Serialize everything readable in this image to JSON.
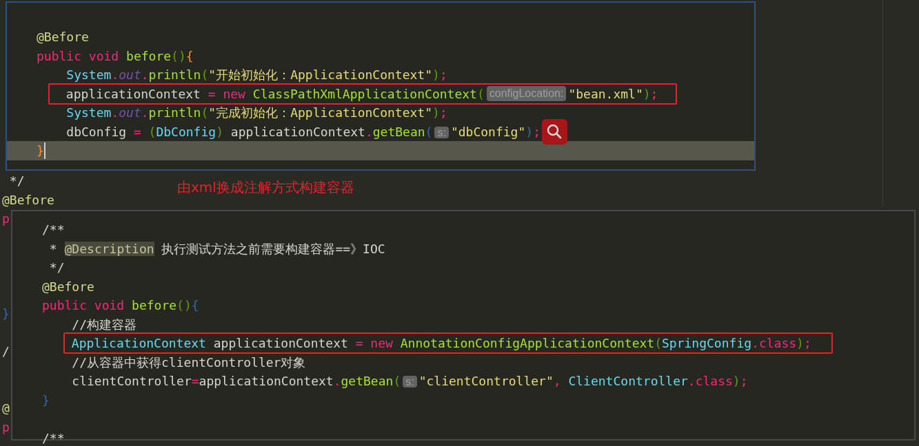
{
  "background_editor": {
    "lines": [
      {
        "segments": [
          {
            "kind": "code",
            "tokens": [
              {
                "kind": "plain",
                "text": " */"
              }
            ]
          }
        ]
      },
      {
        "segments": [
          {
            "kind": "code",
            "tokens": [
              {
                "kind": "annotation",
                "text": "@Before"
              }
            ]
          }
        ]
      },
      {
        "segments": [
          {
            "kind": "code",
            "tokens": [
              {
                "kind": "keyword",
                "text": "p"
              }
            ]
          }
        ]
      },
      {
        "segments": [
          {
            "kind": "code",
            "tokens": [
              {
                "kind": "bracket",
                "text": "}"
              }
            ]
          }
        ]
      },
      {
        "segments": [
          {
            "kind": "code",
            "tokens": [
              {
                "kind": "plain",
                "text": "/"
              }
            ]
          }
        ]
      },
      {
        "segments": [
          {
            "kind": "code",
            "tokens": [
              {
                "kind": "annotation",
                "text": "@"
              }
            ]
          }
        ]
      },
      {
        "segments": [
          {
            "kind": "code",
            "tokens": [
              {
                "kind": "keyword",
                "text": "p"
              }
            ]
          }
        ]
      }
    ]
  },
  "top_panel": {
    "lines": [
      {
        "kind": "plain",
        "segments": [
          {
            "kind": "code",
            "tokens": [
              {
                "kind": "annotation",
                "text": "@Before"
              }
            ]
          }
        ]
      },
      {
        "kind": "plain",
        "segments": [
          {
            "kind": "code",
            "tokens": [
              {
                "kind": "keyword",
                "text": "public void "
              },
              {
                "kind": "function",
                "text": "before"
              },
              {
                "kind": "paren",
                "text": "()"
              },
              {
                "kind": "brace",
                "text": "{"
              }
            ]
          }
        ]
      },
      {
        "kind": "plain",
        "segments": [
          {
            "kind": "code",
            "tokens": [
              {
                "kind": "type",
                "text": "    System"
              },
              {
                "kind": "keyword",
                "text": "."
              },
              {
                "kind": "field",
                "text": "out"
              },
              {
                "kind": "keyword",
                "text": "."
              },
              {
                "kind": "function",
                "text": "println"
              },
              {
                "kind": "paren",
                "text": "("
              },
              {
                "kind": "string",
                "text": "\"开始初始化：ApplicationContext\""
              },
              {
                "kind": "paren",
                "text": ")"
              },
              {
                "kind": "keyword",
                "text": ";"
              }
            ]
          }
        ]
      },
      {
        "kind": "boxed",
        "segments": [
          {
            "kind": "code",
            "tokens": [
              {
                "kind": "plain",
                "text": "    applicationContext "
              },
              {
                "kind": "keyword",
                "text": "= new "
              },
              {
                "kind": "function",
                "text": "ClassPathXmlApplicationContext"
              },
              {
                "kind": "paren",
                "text": "("
              }
            ]
          },
          {
            "kind": "hint",
            "text": "configLocation:"
          },
          {
            "kind": "code",
            "tokens": [
              {
                "kind": "string",
                "text": "\"bean.xml\""
              },
              {
                "kind": "paren",
                "text": ")"
              },
              {
                "kind": "keyword",
                "text": ";"
              }
            ]
          }
        ]
      },
      {
        "kind": "plain",
        "segments": [
          {
            "kind": "code",
            "tokens": [
              {
                "kind": "type",
                "text": "    System"
              },
              {
                "kind": "keyword",
                "text": "."
              },
              {
                "kind": "field",
                "text": "out"
              },
              {
                "kind": "keyword",
                "text": "."
              },
              {
                "kind": "function",
                "text": "println"
              },
              {
                "kind": "paren",
                "text": "("
              },
              {
                "kind": "string",
                "text": "\"完成初始化：ApplicationContext\""
              },
              {
                "kind": "paren",
                "text": ")"
              },
              {
                "kind": "keyword",
                "text": ";"
              }
            ]
          }
        ]
      },
      {
        "kind": "search",
        "segments": [
          {
            "kind": "code",
            "tokens": [
              {
                "kind": "plain",
                "text": "    dbConfig "
              },
              {
                "kind": "keyword",
                "text": "= "
              },
              {
                "kind": "paren",
                "text": "("
              },
              {
                "kind": "type",
                "text": "DbConfig"
              },
              {
                "kind": "paren",
                "text": ") "
              },
              {
                "kind": "plain",
                "text": "applicationContext"
              },
              {
                "kind": "keyword",
                "text": "."
              },
              {
                "kind": "function",
                "text": "getBean"
              },
              {
                "kind": "bracket",
                "text": "("
              }
            ]
          },
          {
            "kind": "hint",
            "text": "s:"
          },
          {
            "kind": "code",
            "tokens": [
              {
                "kind": "string",
                "text": "\"dbConfig\""
              },
              {
                "kind": "bracket",
                "text": ")"
              },
              {
                "kind": "keyword",
                "text": ";"
              }
            ]
          }
        ]
      },
      {
        "kind": "current",
        "segments": [
          {
            "kind": "code",
            "tokens": [
              {
                "kind": "brace",
                "text": "}"
              }
            ]
          }
        ]
      }
    ]
  },
  "annotation": "由xml换成注解方式构建容器",
  "bottom_panel": {
    "lines": [
      {
        "kind": "plain",
        "segments": [
          {
            "kind": "code",
            "tokens": [
              {
                "kind": "plain",
                "text": "/**"
              }
            ]
          }
        ]
      },
      {
        "kind": "plain",
        "segments": [
          {
            "kind": "code",
            "tokens": [
              {
                "kind": "plain",
                "text": " * "
              },
              {
                "kind": "doc_tag",
                "text": "@Description"
              },
              {
                "kind": "plain",
                "text": " 执行测试方法之前需要构建容器==》IOC"
              }
            ]
          }
        ]
      },
      {
        "kind": "plain",
        "segments": [
          {
            "kind": "code",
            "tokens": [
              {
                "kind": "plain",
                "text": " */"
              }
            ]
          }
        ]
      },
      {
        "kind": "plain",
        "segments": [
          {
            "kind": "code",
            "tokens": [
              {
                "kind": "annotation",
                "text": "@Before"
              }
            ]
          }
        ]
      },
      {
        "kind": "plain",
        "segments": [
          {
            "kind": "code",
            "tokens": [
              {
                "kind": "keyword",
                "text": "public void "
              },
              {
                "kind": "function",
                "text": "before"
              },
              {
                "kind": "paren",
                "text": "()"
              },
              {
                "kind": "bracket",
                "text": "{"
              }
            ]
          }
        ]
      },
      {
        "kind": "plain",
        "segments": [
          {
            "kind": "code",
            "tokens": [
              {
                "kind": "plain",
                "text": "    //构建容器"
              }
            ]
          }
        ]
      },
      {
        "kind": "boxed",
        "segments": [
          {
            "kind": "code",
            "tokens": [
              {
                "kind": "type",
                "text": "    ApplicationContext "
              },
              {
                "kind": "plain",
                "text": "applicationContext "
              },
              {
                "kind": "keyword",
                "text": "= new "
              },
              {
                "kind": "function",
                "text": "AnnotationConfigApplicationContext"
              },
              {
                "kind": "paren",
                "text": "("
              },
              {
                "kind": "type",
                "text": "SpringConfig"
              },
              {
                "kind": "keyword",
                "text": ".class"
              },
              {
                "kind": "paren",
                "text": ")"
              },
              {
                "kind": "keyword",
                "text": ";"
              }
            ]
          }
        ]
      },
      {
        "kind": "plain",
        "segments": [
          {
            "kind": "code",
            "tokens": [
              {
                "kind": "plain",
                "text": "    //从容器中获得clientController对象"
              }
            ]
          }
        ]
      },
      {
        "kind": "plain",
        "segments": [
          {
            "kind": "code",
            "tokens": [
              {
                "kind": "plain",
                "text": "    clientController"
              },
              {
                "kind": "keyword",
                "text": "="
              },
              {
                "kind": "plain",
                "text": "applicationContext"
              },
              {
                "kind": "keyword",
                "text": "."
              },
              {
                "kind": "function",
                "text": "getBean"
              },
              {
                "kind": "paren",
                "text": "("
              }
            ]
          },
          {
            "kind": "hint",
            "text": "s:"
          },
          {
            "kind": "code",
            "tokens": [
              {
                "kind": "string",
                "text": "\"clientController\""
              },
              {
                "kind": "keyword",
                "text": ", "
              },
              {
                "kind": "type",
                "text": "ClientController"
              },
              {
                "kind": "keyword",
                "text": ".class"
              },
              {
                "kind": "paren",
                "text": ")"
              },
              {
                "kind": "keyword",
                "text": ";"
              }
            ]
          }
        ]
      },
      {
        "kind": "plain",
        "segments": [
          {
            "kind": "code",
            "tokens": [
              {
                "kind": "bracket",
                "text": "}"
              }
            ]
          }
        ]
      },
      {
        "kind": "plain",
        "segments": [
          {
            "kind": "code",
            "tokens": [
              {
                "kind": "plain",
                "text": "/**"
              }
            ]
          }
        ]
      }
    ]
  }
}
